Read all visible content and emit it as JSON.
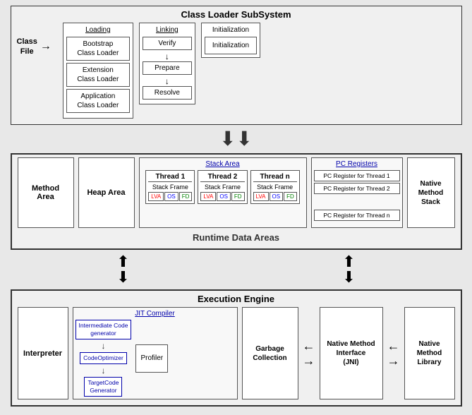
{
  "cls": {
    "title": "Class Loader SubSystem",
    "loading": {
      "label": "Loading",
      "items": [
        "Bootstrap\nClass Loader",
        "Extension\nClass Loader",
        "Application\nClass Loader"
      ]
    },
    "classFile": {
      "line1": "Class",
      "line2": "File"
    },
    "linking": {
      "label": "Linking",
      "items": [
        "Verify",
        "Prepare",
        "Resolve"
      ]
    },
    "initialization": {
      "label": "Initialization",
      "inner": "Initialization"
    }
  },
  "rda": {
    "title": "Runtime Data Areas",
    "stackArea": {
      "label": "Stack Area",
      "threads": [
        {
          "label": "Thread 1",
          "lva": [
            "LVA",
            "OS",
            "FD"
          ]
        },
        {
          "label": "Thread 2",
          "lva": [
            "LVA",
            "OS",
            "FD"
          ]
        },
        {
          "label": "Thread n",
          "lva": [
            "LVA",
            "OS",
            "FD"
          ]
        }
      ],
      "stackFrame": "Stack Frame"
    },
    "methodArea": "Method\nArea",
    "heapArea": "Heap Area",
    "pcRegisters": {
      "label": "PC Registers",
      "items": [
        "PC Register for Thread 1",
        "PC Register for Thread 2",
        "PC Register for Thread n"
      ]
    },
    "nativeMethodStack": "Native\nMethod\nStack"
  },
  "ee": {
    "title": "Execution Engine",
    "interpreter": "Interpreter",
    "jit": {
      "label": "JIT Compiler",
      "items": [
        "Intermediate Code\ngenerator",
        "CodeOptimizer",
        "TargetCode\nGenerator"
      ]
    },
    "profiler": "Profiler",
    "garbageCollection": "Garbage\nCollection",
    "nativeMethodInterface": "Native Method\nInterface\n(JNI)",
    "nativeMethodLibrary": "Native Method\nLibrary"
  }
}
